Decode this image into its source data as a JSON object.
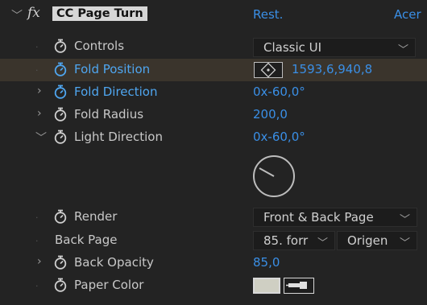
{
  "header": {
    "effect_name": "CC Page Turn",
    "fx_label": "fx",
    "reset_label": "Rest.",
    "about_label": "Acer"
  },
  "properties": {
    "controls": {
      "label": "Controls",
      "value": "Classic UI"
    },
    "fold_position": {
      "label": "Fold Position",
      "value": "1593,6,940,8"
    },
    "fold_direction": {
      "label": "Fold Direction",
      "value": "0x-60,0°"
    },
    "fold_radius": {
      "label": "Fold Radius",
      "value": "200,0"
    },
    "light_direction": {
      "label": "Light Direction",
      "value": "0x-60,0°"
    },
    "render": {
      "label": "Render",
      "value": "Front & Back Page"
    },
    "back_page": {
      "label": "Back Page",
      "layer": "85. forr",
      "source": "Origen"
    },
    "back_opacity": {
      "label": "Back Opacity",
      "value": "85,0"
    },
    "paper_color": {
      "label": "Paper Color",
      "color": "#cfcfc3"
    }
  },
  "colors": {
    "background": "#232323",
    "highlight_row": "#3a342c",
    "value_blue": "#3a8fe6",
    "label_blue": "#4fa6f0"
  }
}
